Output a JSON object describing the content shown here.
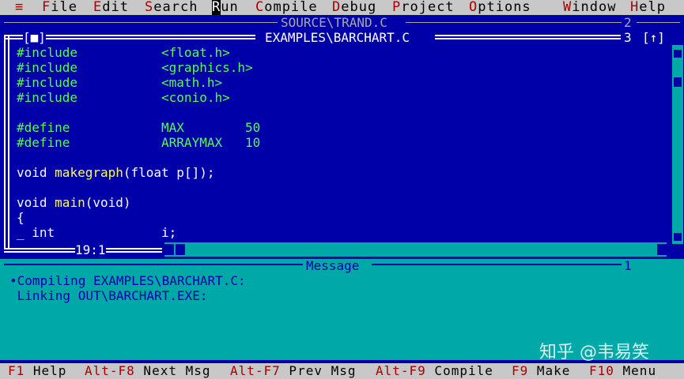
{
  "menu": [
    {
      "hotkey": "≡",
      "rest": "",
      "name": "system-menu"
    },
    {
      "hotkey": "F",
      "rest": "ile",
      "name": "menu-file"
    },
    {
      "hotkey": "E",
      "rest": "dit",
      "name": "menu-edit"
    },
    {
      "hotkey": "S",
      "rest": "earch",
      "name": "menu-search"
    },
    {
      "hotkey": "R",
      "rest": "un",
      "name": "menu-run"
    },
    {
      "hotkey": "C",
      "rest": "ompile",
      "name": "menu-compile"
    },
    {
      "hotkey": "D",
      "rest": "ebug",
      "name": "menu-debug"
    },
    {
      "hotkey": "P",
      "rest": "roject",
      "name": "menu-project"
    },
    {
      "hotkey": "O",
      "rest": "ptions",
      "name": "menu-options"
    },
    {
      "hotkey": "W",
      "rest": "indow",
      "name": "menu-window"
    },
    {
      "hotkey": "H",
      "rest": "elp",
      "name": "menu-help"
    }
  ],
  "back_window": {
    "title": "SOURCE\\TRAND.C",
    "number": "2"
  },
  "editor": {
    "close_box": "[■]",
    "title": "EXAMPLES\\BARCHART.C",
    "number": "3",
    "zoom_box": "[↑]",
    "cursor_position": "19:1",
    "lines": [
      [
        {
          "c": "kw",
          "t": "#include           "
        },
        {
          "c": "kw",
          "t": "<float.h>"
        }
      ],
      [
        {
          "c": "kw",
          "t": "#include           "
        },
        {
          "c": "kw",
          "t": "<graphics.h>"
        }
      ],
      [
        {
          "c": "kw",
          "t": "#include           "
        },
        {
          "c": "kw",
          "t": "<math.h>"
        }
      ],
      [
        {
          "c": "kw",
          "t": "#include           "
        },
        {
          "c": "kw",
          "t": "<conio.h>"
        }
      ],
      [],
      [
        {
          "c": "kw",
          "t": "#define            "
        },
        {
          "c": "kw",
          "t": "MAX        50"
        }
      ],
      [
        {
          "c": "kw",
          "t": "#define            "
        },
        {
          "c": "kw",
          "t": "ARRAYMAX   10"
        }
      ],
      [],
      [
        {
          "c": "pl",
          "t": "void "
        },
        {
          "c": "id",
          "t": "makegraph"
        },
        {
          "c": "pl",
          "t": "(float p[]);"
        }
      ],
      [],
      [
        {
          "c": "pl",
          "t": "void "
        },
        {
          "c": "id",
          "t": "main"
        },
        {
          "c": "pl",
          "t": "(void)"
        }
      ],
      [
        {
          "c": "pl",
          "t": "{"
        }
      ],
      [
        {
          "c": "pl",
          "t": "_ int              i;"
        }
      ]
    ]
  },
  "message_window": {
    "title": "Message",
    "number": "1",
    "lines": [
      "•Compiling EXAMPLES\\BARCHART.C:",
      " Linking OUT\\BARCHART.EXE:"
    ]
  },
  "status": [
    {
      "key": "F1",
      "desc": "Help",
      "name": "status-f1-help"
    },
    {
      "key": "Alt-F8",
      "desc": "Next Msg",
      "name": "status-next-msg"
    },
    {
      "key": "Alt-F7",
      "desc": "Prev Msg",
      "name": "status-prev-msg"
    },
    {
      "key": "Alt-F9",
      "desc": "Compile",
      "name": "status-compile"
    },
    {
      "key": "F9",
      "desc": "Make",
      "name": "status-make"
    },
    {
      "key": "F10",
      "desc": "Menu",
      "name": "status-menu"
    }
  ],
  "watermark": "知乎 @韦易笑",
  "colors": {
    "editor_bg": "#0000a8",
    "message_bg": "#00a8a8",
    "menu_bg": "#c8c8c8",
    "hotkey": "#a80000",
    "directive": "#54fc54",
    "identifier": "#fcfc54"
  }
}
